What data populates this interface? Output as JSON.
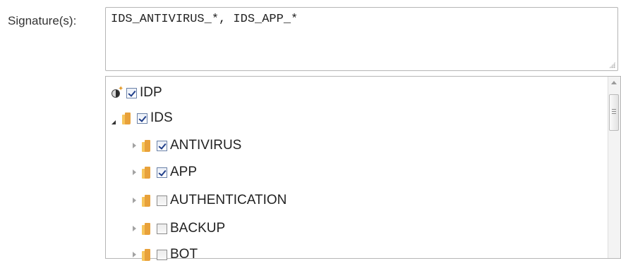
{
  "signatures": {
    "label": "Signature(s):",
    "value": "IDS_ANTIVIRUS_*, IDS_APP_*"
  },
  "tree": {
    "root": {
      "label": "IDP",
      "checked": true,
      "icon": "idp-root-icon"
    },
    "items": [
      {
        "label": "IDS",
        "checked": true,
        "expanded": true,
        "level": 1
      },
      {
        "label": "ANTIVIRUS",
        "checked": true,
        "expanded": false,
        "level": 2
      },
      {
        "label": "APP",
        "checked": true,
        "expanded": false,
        "level": 2
      },
      {
        "label": "AUTHENTICATION",
        "checked": false,
        "expanded": false,
        "level": 2
      },
      {
        "label": "BACKUP",
        "checked": false,
        "expanded": false,
        "level": 2
      },
      {
        "label": "BOT",
        "checked": false,
        "expanded": false,
        "level": 2
      }
    ]
  },
  "colors": {
    "folder": "#e8a13a",
    "check": "#203f8a",
    "border": "#b5b5b5"
  }
}
